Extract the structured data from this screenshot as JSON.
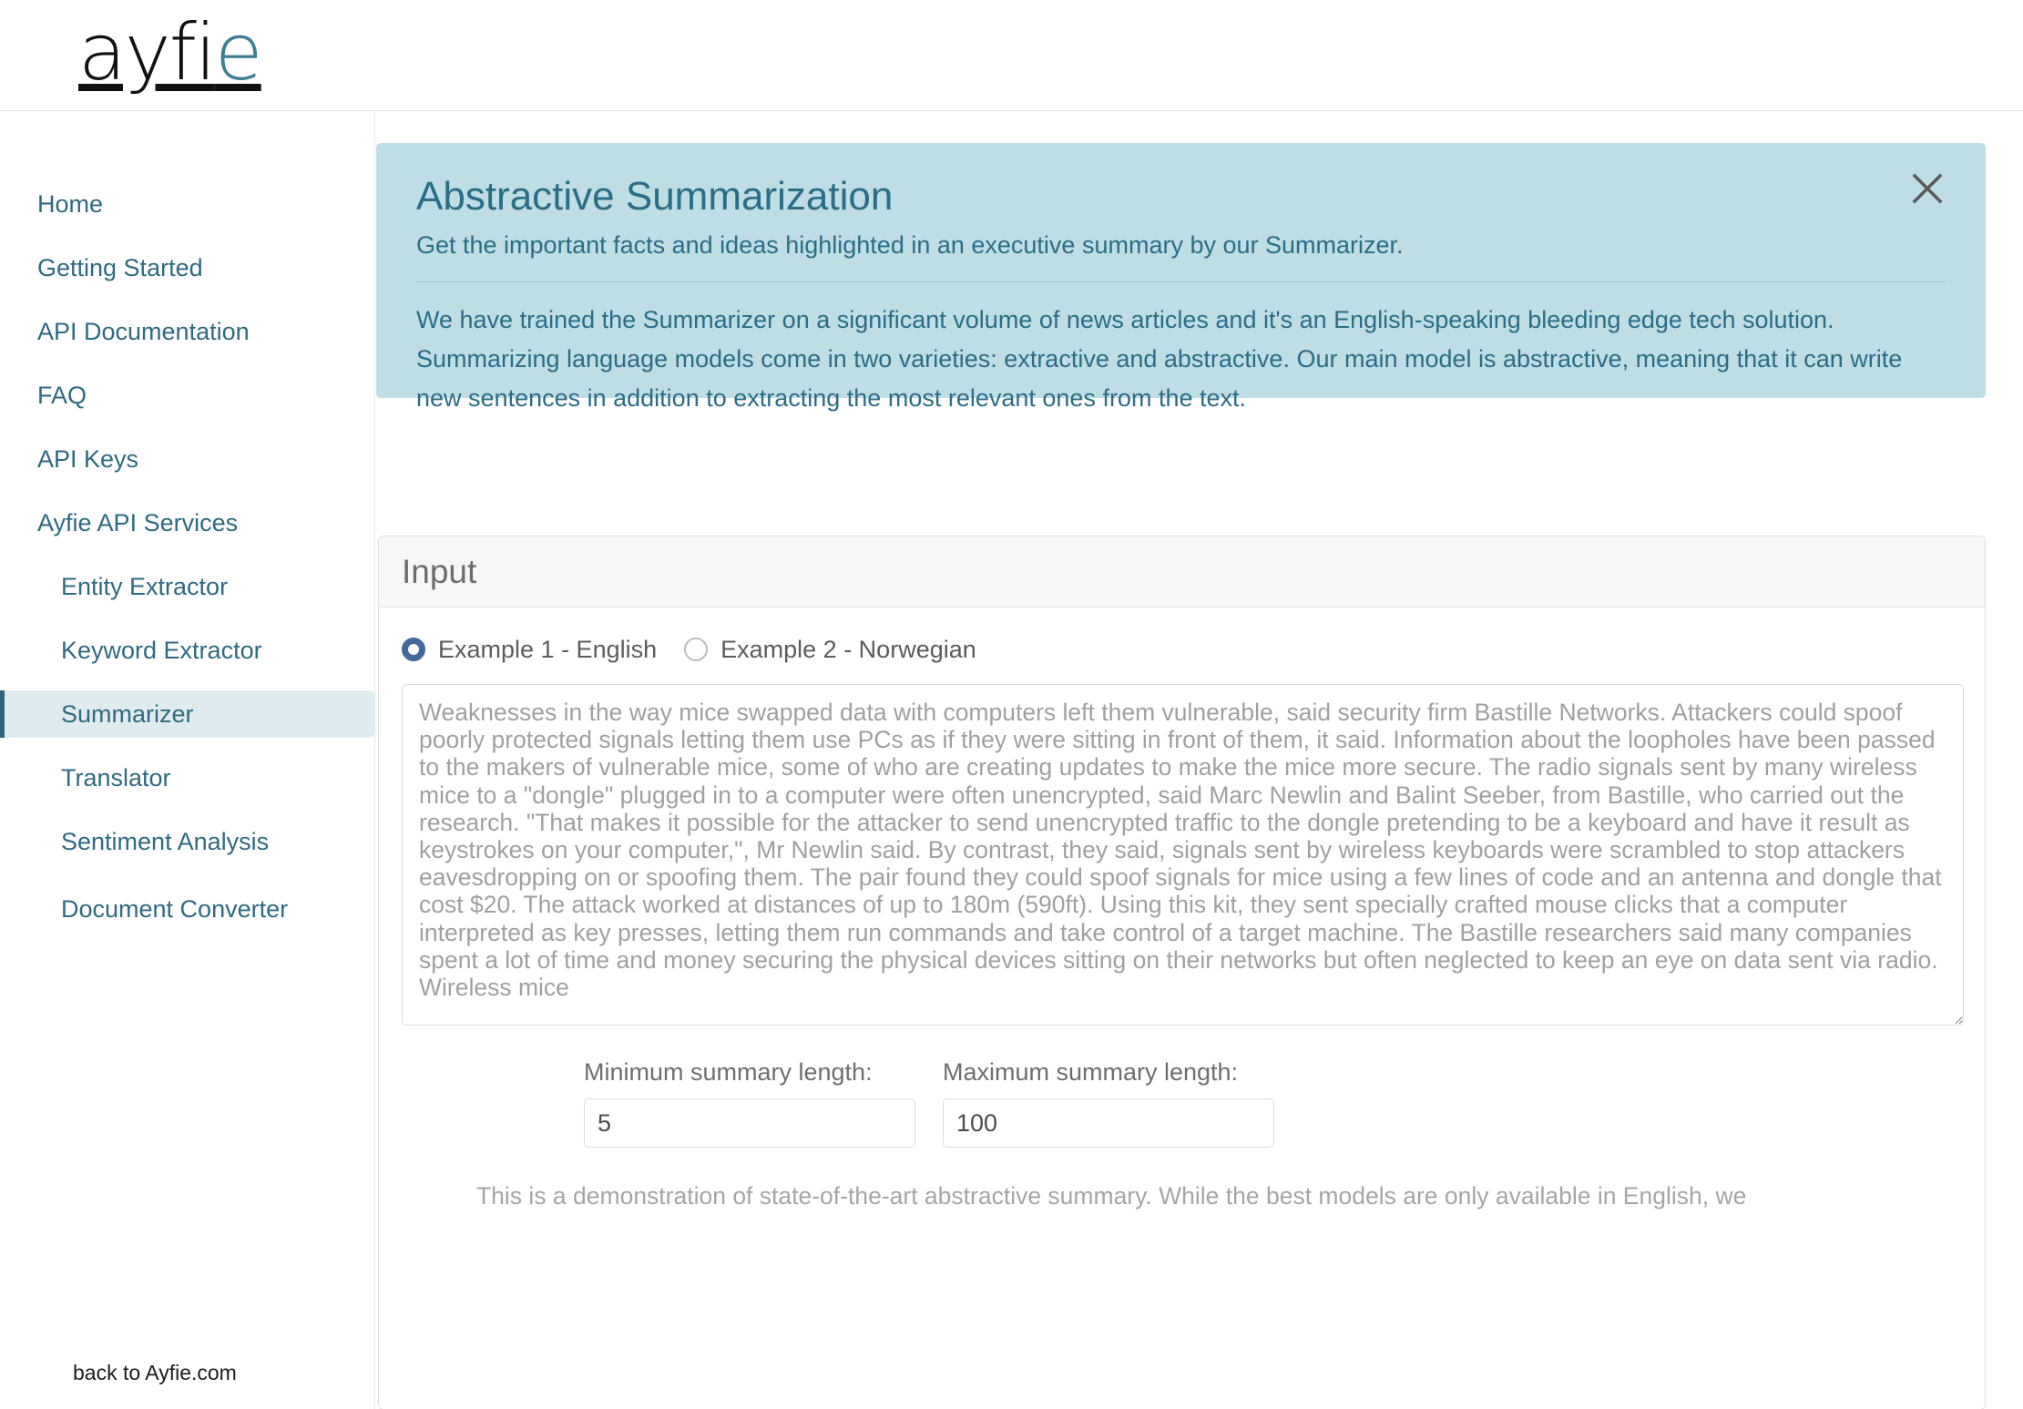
{
  "brand": {
    "logo_text_dark": "ayfi",
    "logo_text_accent": "e",
    "accent_color": "#3d7e96"
  },
  "sidebar": {
    "items": [
      {
        "label": "Home",
        "sub": false,
        "active": false
      },
      {
        "label": "Getting Started",
        "sub": false,
        "active": false
      },
      {
        "label": "API Documentation",
        "sub": false,
        "active": false
      },
      {
        "label": "FAQ",
        "sub": false,
        "active": false
      },
      {
        "label": "API Keys",
        "sub": false,
        "active": false
      },
      {
        "label": "Ayfie API Services",
        "sub": false,
        "active": false
      },
      {
        "label": "Entity Extractor",
        "sub": true,
        "active": false
      },
      {
        "label": "Keyword Extractor",
        "sub": true,
        "active": false
      },
      {
        "label": "Summarizer",
        "sub": true,
        "active": true
      },
      {
        "label": "Translator",
        "sub": true,
        "active": false
      },
      {
        "label": "Sentiment Analysis",
        "sub": true,
        "active": false
      },
      {
        "label": "Document Converter",
        "sub": true,
        "active": false
      }
    ],
    "back_link": "back to Ayfie.com"
  },
  "banner": {
    "title": "Abstractive Summarization",
    "subtitle": "Get the important facts and ideas highlighted in an executive summary by our Summarizer.",
    "body": "We have trained the Summarizer on a significant volume of news articles and it's an English-speaking bleeding edge tech solution. Summarizing language models come in two varieties: extractive and abstractive. Our main model is abstractive, meaning that it can write new sentences in addition to extracting the most relevant ones from the text.",
    "background_color": "#bedde5",
    "text_color": "#2c6d86",
    "close_icon": "close-icon"
  },
  "input_card": {
    "title": "Input",
    "examples": [
      {
        "label": "Example 1 - English",
        "selected": true
      },
      {
        "label": "Example 2 - Norwegian",
        "selected": false
      }
    ],
    "text_value": "Weaknesses in the way mice swapped data with computers left them vulnerable, said security firm Bastille Networks. Attackers could spoof poorly protected signals letting them use PCs as if they were sitting in front of them, it said. Information about the loopholes have been passed to the makers of vulnerable mice, some of who are creating updates to make the mice more secure. The radio signals sent by many wireless mice to a \"dongle\" plugged in to a computer were often unencrypted, said Marc Newlin and Balint Seeber, from Bastille, who carried out the research. \"That makes it possible for the attacker to send unencrypted traffic to the dongle pretending to be a keyboard and have it result as keystrokes on your computer,\", Mr Newlin said. By contrast, they said, signals sent by wireless keyboards were scrambled to stop attackers eavesdropping on or spoofing them. The pair found they could spoof signals for mice using a few lines of code and an antenna and dongle that cost $20. The attack worked at distances of up to 180m (590ft). Using this kit, they sent specially crafted mouse clicks that a computer interpreted as key presses, letting them run commands and take control of a target machine. The Bastille researchers said many companies spent a lot of time and money securing the physical devices sitting on their networks but often neglected to keep an eye on data sent via radio. Wireless mice",
    "min_label": "Minimum summary length:",
    "min_value": "5",
    "max_label": "Maximum summary length:",
    "max_value": "100",
    "demo_note": "This is a demonstration of state-of-the-art abstractive summary. While the best models are only available in English, we"
  }
}
